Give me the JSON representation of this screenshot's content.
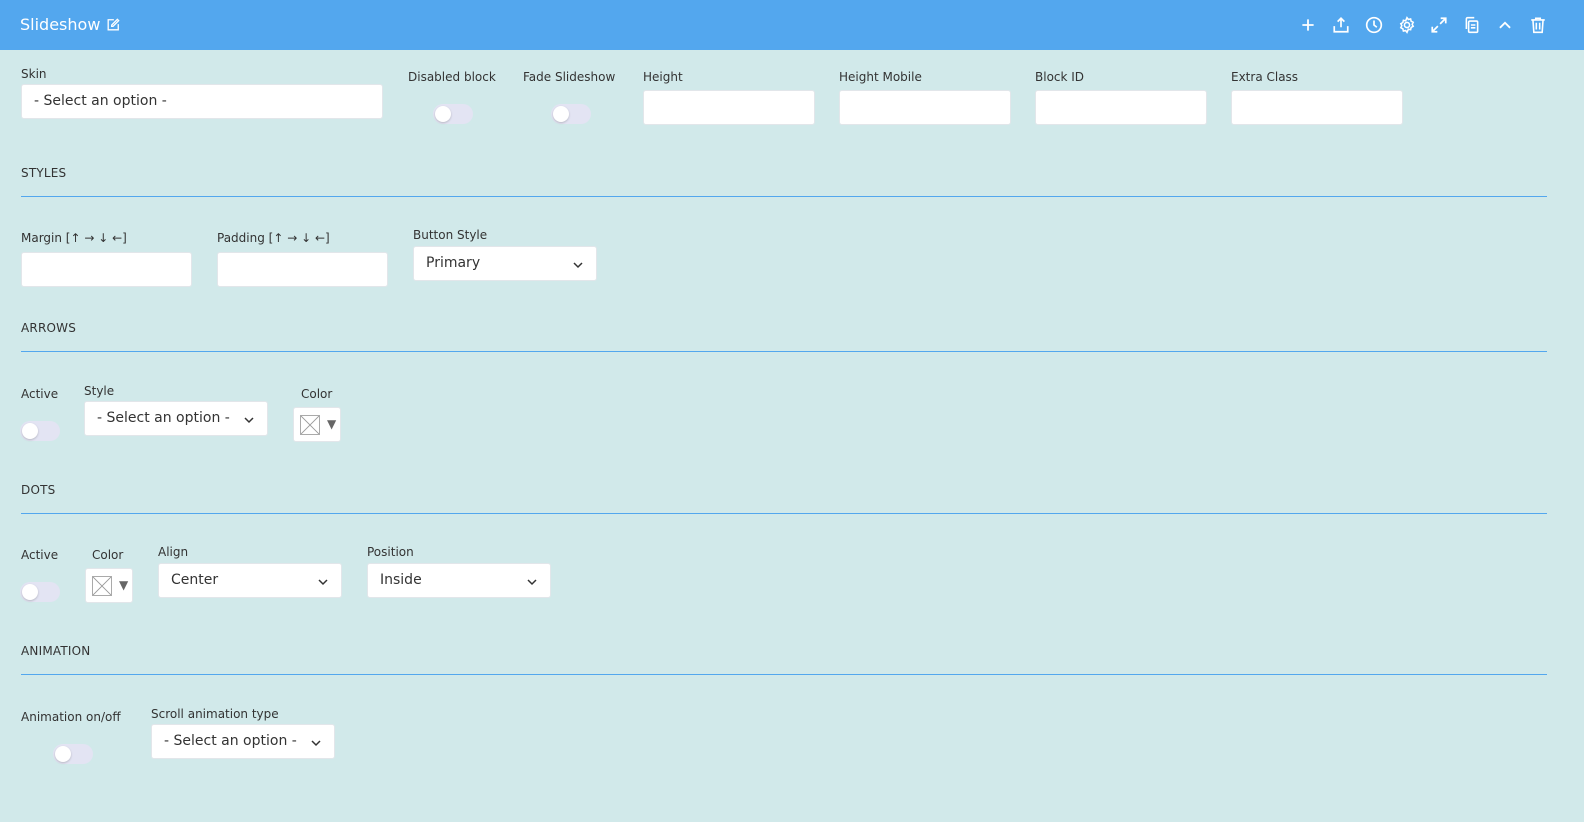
{
  "header": {
    "title": "Slideshow",
    "accent": "#53a7ee",
    "tools": [
      "add-icon",
      "upload-icon",
      "history-icon",
      "settings-icon",
      "expand-icon",
      "copy-icon",
      "collapse-icon",
      "trash-icon"
    ]
  },
  "general": {
    "skin_label": "Skin",
    "skin_value": "- Select an option -",
    "disabled_label": "Disabled block",
    "fade_label": "Fade Slideshow",
    "height_label": "Height",
    "height_mobile_label": "Height Mobile",
    "block_id_label": "Block ID",
    "extra_class_label": "Extra Class"
  },
  "styles": {
    "section": "STYLES",
    "margin_label": "Margin [↑ → ↓ ←]",
    "padding_label": "Padding [↑ → ↓ ←]",
    "button_style_label": "Button Style",
    "button_style_value": "Primary"
  },
  "arrows": {
    "section": "ARROWS",
    "active_label": "Active",
    "style_label": "Style",
    "style_value": "- Select an option -",
    "color_label": "Color"
  },
  "dots": {
    "section": "DOTS",
    "active_label": "Active",
    "color_label": "Color",
    "align_label": "Align",
    "align_value": "Center",
    "position_label": "Position",
    "position_value": "Inside"
  },
  "animation": {
    "section": "ANIMATION",
    "toggle_label": "Animation on/off",
    "type_label": "Scroll animation type",
    "type_value": "- Select an option -"
  }
}
